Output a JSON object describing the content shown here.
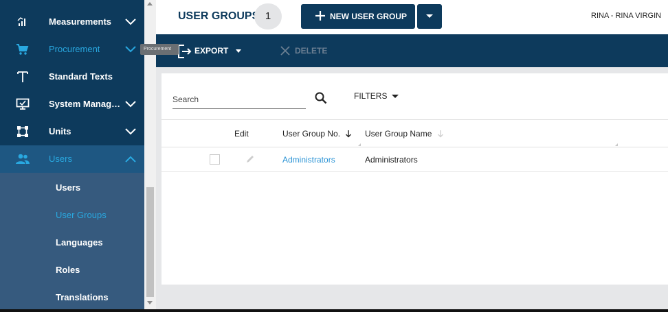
{
  "sidebar": {
    "items": [
      {
        "label": "Measurements",
        "icon": "measurements-icon"
      },
      {
        "label": "Procurement",
        "icon": "cart-icon"
      },
      {
        "label": "Standard Texts",
        "icon": "text-icon"
      },
      {
        "label": "System Manage...",
        "icon": "monitor-icon"
      },
      {
        "label": "Units",
        "icon": "units-icon"
      },
      {
        "label": "Users",
        "icon": "users-icon"
      }
    ],
    "users_submenu": [
      "Users",
      "User Groups",
      "Languages",
      "Roles",
      "Translations"
    ],
    "tooltip": "Procurement"
  },
  "header": {
    "title": "USER GROUPS",
    "count": "1",
    "new_button": "NEW USER GROUP",
    "user": "RINA - RINA VIRGIN"
  },
  "toolbar": {
    "export": "EXPORT",
    "delete": "DELETE"
  },
  "search": {
    "placeholder": "Search",
    "filters": "FILTERS"
  },
  "table": {
    "columns": [
      "Edit",
      "User Group No.",
      "User Group Name"
    ],
    "rows": [
      {
        "number": "Administrators",
        "name": "Administrators"
      }
    ]
  },
  "colors": {
    "navy": "#0d3a5c",
    "accent": "#29a8e0",
    "submenu_bg": "#365a7e",
    "link": "#2a93d5"
  }
}
